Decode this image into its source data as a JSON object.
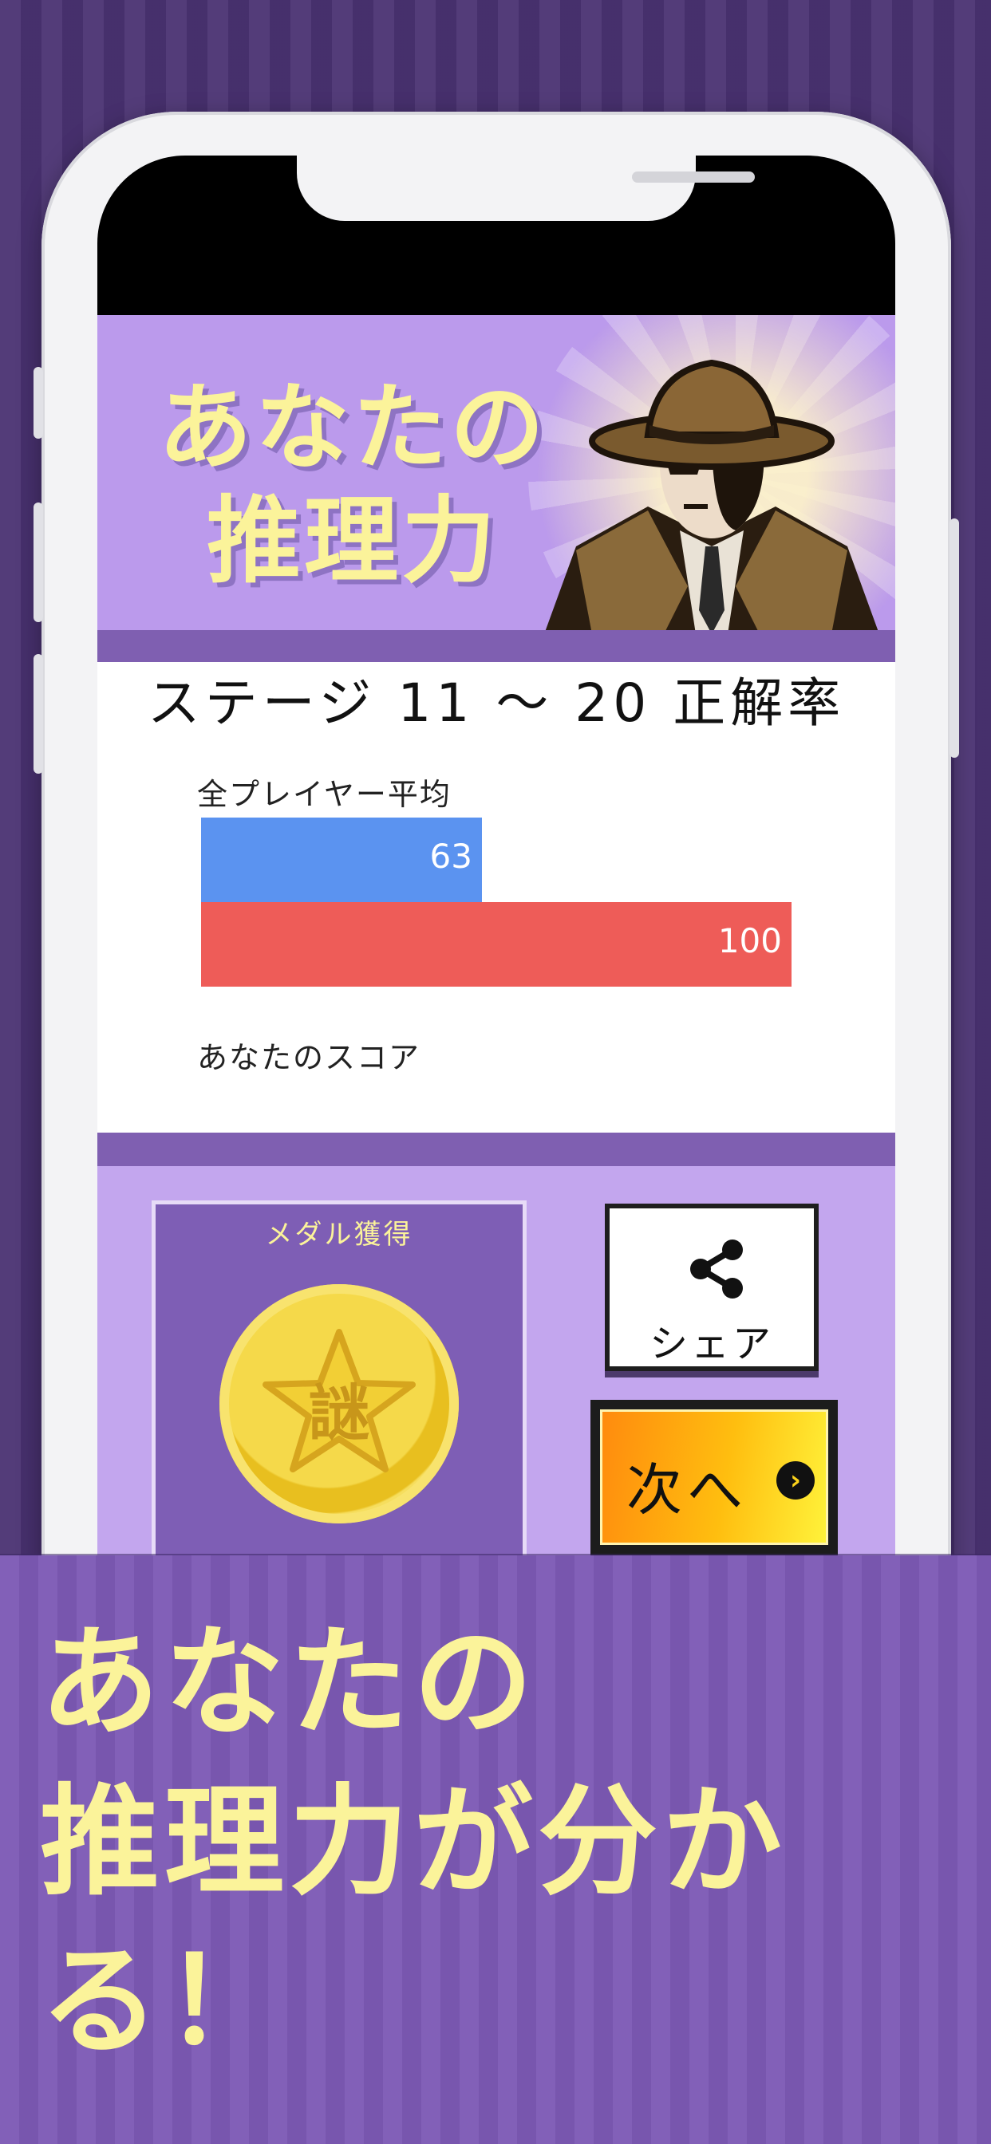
{
  "banner": {
    "title_line1": "あなたの",
    "title_line2": "推理力"
  },
  "result": {
    "title": "ステージ 11 ～ 20 正解率",
    "average_label": "全プレイヤー平均",
    "your_label": "あなたのスコア",
    "average_value": 63,
    "your_value": 100,
    "max_value": 100,
    "average_color": "#5b93f0",
    "your_color": "#ee5c58"
  },
  "medal": {
    "label": "メダル獲得",
    "kanji": "謎"
  },
  "buttons": {
    "share_label": "シェア",
    "next_label": "次へ",
    "next_arrow": "›"
  },
  "tagline": {
    "line1": "あなたの",
    "line2": "推理力が分かる！"
  },
  "colors": {
    "background": "#4a3272",
    "accent_yellow": "#fbf39a",
    "panel_purple": "#c3a6ee"
  }
}
